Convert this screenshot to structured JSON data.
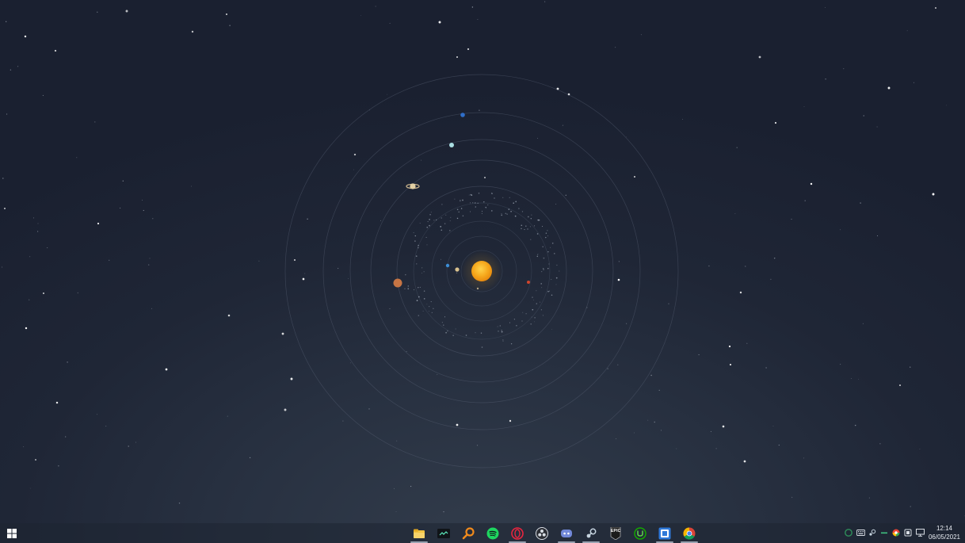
{
  "wallpaper": {
    "sun_color": "#f6a81c",
    "orbit_color": "#5a6478",
    "background_colors": [
      "#1a2030",
      "#323c4b"
    ]
  },
  "taskbar": {
    "start_icon": "windows-logo-icon",
    "apps": [
      {
        "name": "file-explorer-icon",
        "pinned_running": true
      },
      {
        "name": "terminal-icon",
        "pinned_running": false
      },
      {
        "name": "search-magnifier-icon",
        "pinned_running": false
      },
      {
        "name": "spotify-icon",
        "pinned_running": false
      },
      {
        "name": "opera-icon",
        "pinned_running": true
      },
      {
        "name": "obs-studio-icon",
        "pinned_running": false
      },
      {
        "name": "discord-icon",
        "pinned_running": true
      },
      {
        "name": "steam-icon",
        "pinned_running": true
      },
      {
        "name": "epic-games-icon",
        "pinned_running": false
      },
      {
        "name": "upwork-icon",
        "pinned_running": false
      },
      {
        "name": "app-window-icon",
        "pinned_running": true
      },
      {
        "name": "chrome-icon",
        "pinned_running": true
      }
    ],
    "epic_label": "EPIC",
    "tray_icons": [
      "status-circle-icon",
      "keyboard-icon",
      "steam-tray-icon",
      "minus-icon",
      "colorful-app-icon",
      "network-device-icon",
      "monitor-icon"
    ],
    "clock": {
      "time": "12:14",
      "date": "06/05/2021"
    }
  }
}
